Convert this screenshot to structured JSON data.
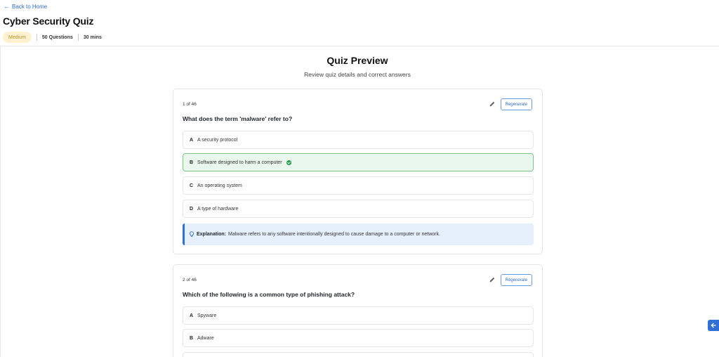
{
  "header": {
    "back_label": "Back to Home",
    "title": "Cyber Security Quiz",
    "difficulty": "Medium",
    "questions_count": "50 Questions",
    "duration": "30 mins"
  },
  "preview": {
    "title": "Quiz Preview",
    "subtitle": "Review quiz details and correct answers"
  },
  "regenerate_label": "Regenerate",
  "questions": [
    {
      "counter": "1 of 46",
      "text": "What does the term 'malware' refer to?",
      "options": [
        {
          "letter": "A",
          "text": "A security protocol"
        },
        {
          "letter": "B",
          "text": "Software designed to harm a computer"
        },
        {
          "letter": "C",
          "text": "An operating system"
        },
        {
          "letter": "D",
          "text": "A type of hardware"
        }
      ],
      "correct": "B",
      "explanation_label": "Explanation:",
      "explanation": "Malware refers to any software intentionally designed to cause damage to a computer or network."
    },
    {
      "counter": "2 of 46",
      "text": "Which of the following is a common type of phishing attack?",
      "options": [
        {
          "letter": "A",
          "text": "Spyware"
        },
        {
          "letter": "B",
          "text": "Adware"
        }
      ]
    }
  ],
  "colors": {
    "accent": "#2f6fd6",
    "correct_bg": "#e9f7ec",
    "correct_border": "#7cc38a",
    "badge_bg": "#fdf1cf",
    "explanation_bg": "#e6f0fd"
  }
}
